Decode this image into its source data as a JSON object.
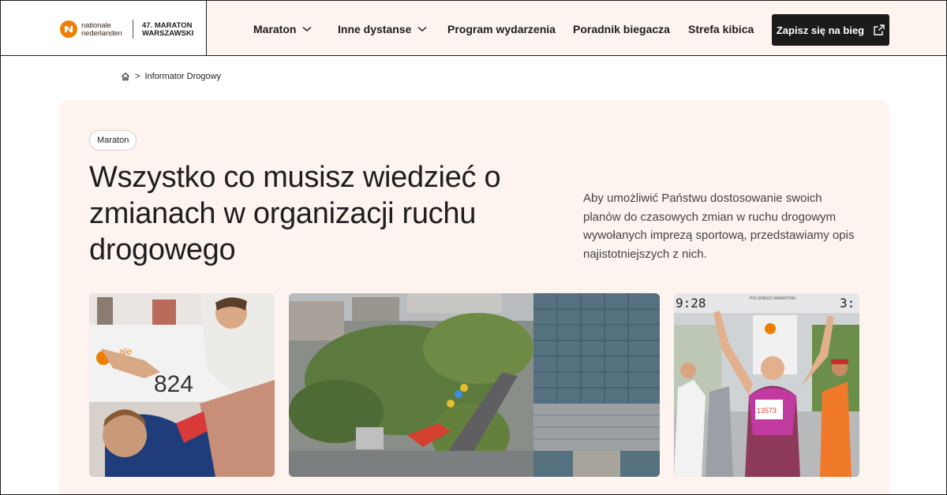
{
  "header": {
    "brand_line1": "nationale",
    "brand_line2": "nederlanden",
    "event_line1": "47. MARATON",
    "event_line2": "WARSZAWSKI",
    "nav": [
      {
        "label": "Maraton",
        "dropdown": true
      },
      {
        "label": "Inne dystanse",
        "dropdown": true
      },
      {
        "label": "Program wydarzenia",
        "dropdown": false
      },
      {
        "label": "Poradnik biegacza",
        "dropdown": false
      },
      {
        "label": "Strefa kibica",
        "dropdown": false
      }
    ],
    "cta_label": "Zapisz się na bieg",
    "colors": {
      "brand_orange": "#ee7f00",
      "nav_bg": "#fdf3ef",
      "cta_bg": "#1b1b1b"
    }
  },
  "breadcrumb": {
    "icon": "home-icon",
    "separator": ">",
    "current": "Informator Drogowy"
  },
  "hero": {
    "tag": "Maraton",
    "title": "Wszystko co musisz wiedzieć o zmianach w organizacji ruchu drogowego",
    "lead": "Aby umożliwić Państwu dostosowanie swoich planów do czasowych zmian w ruchu drogowym wywołanych imprezą sportową, przedstawiamy opis najistotniejszych z nich.",
    "photos": [
      {
        "name": "high-five-photo",
        "bib": "824"
      },
      {
        "name": "aerial-city-photo"
      },
      {
        "name": "finish-line-photo",
        "clock_left": "9:28",
        "clock_right": "3:",
        "banner": "POLSKIEGO MARATONU",
        "bib_runner": "13573"
      }
    ]
  }
}
